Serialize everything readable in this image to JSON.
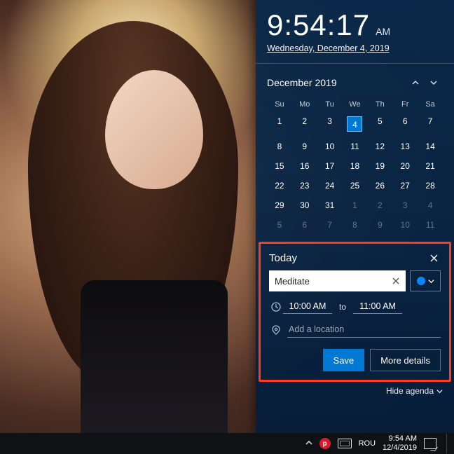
{
  "clock": {
    "time": "9:54:17",
    "ampm": "AM",
    "full_date": "Wednesday, December 4, 2019"
  },
  "calendar": {
    "month_label": "December 2019",
    "dow": [
      "Su",
      "Mo",
      "Tu",
      "We",
      "Th",
      "Fr",
      "Sa"
    ],
    "weeks": [
      [
        {
          "n": 1
        },
        {
          "n": 2
        },
        {
          "n": 3
        },
        {
          "n": 4,
          "today": true
        },
        {
          "n": 5
        },
        {
          "n": 6
        },
        {
          "n": 7
        }
      ],
      [
        {
          "n": 8
        },
        {
          "n": 9
        },
        {
          "n": 10
        },
        {
          "n": 11
        },
        {
          "n": 12
        },
        {
          "n": 13
        },
        {
          "n": 14
        }
      ],
      [
        {
          "n": 15
        },
        {
          "n": 16
        },
        {
          "n": 17
        },
        {
          "n": 18
        },
        {
          "n": 19
        },
        {
          "n": 20
        },
        {
          "n": 21
        }
      ],
      [
        {
          "n": 22
        },
        {
          "n": 23
        },
        {
          "n": 24
        },
        {
          "n": 25
        },
        {
          "n": 26
        },
        {
          "n": 27
        },
        {
          "n": 28
        }
      ],
      [
        {
          "n": 29
        },
        {
          "n": 30
        },
        {
          "n": 31
        },
        {
          "n": 1,
          "dim": true
        },
        {
          "n": 2,
          "dim": true
        },
        {
          "n": 3,
          "dim": true
        },
        {
          "n": 4,
          "dim": true
        }
      ],
      [
        {
          "n": 5,
          "dim": true
        },
        {
          "n": 6,
          "dim": true
        },
        {
          "n": 7,
          "dim": true
        },
        {
          "n": 8,
          "dim": true
        },
        {
          "n": 9,
          "dim": true
        },
        {
          "n": 10,
          "dim": true
        },
        {
          "n": 11,
          "dim": true
        }
      ]
    ]
  },
  "event": {
    "header": "Today",
    "title_value": "Meditate",
    "start": "10:00 AM",
    "to_label": "to",
    "end": "11:00 AM",
    "location_placeholder": "Add a location",
    "save_label": "Save",
    "more_label": "More details",
    "calendar_color": "#0a84ff"
  },
  "hide_agenda_label": "Hide agenda",
  "taskbar": {
    "lang": "ROU",
    "time": "9:54 AM",
    "date": "12/4/2019",
    "p_label": "p"
  }
}
